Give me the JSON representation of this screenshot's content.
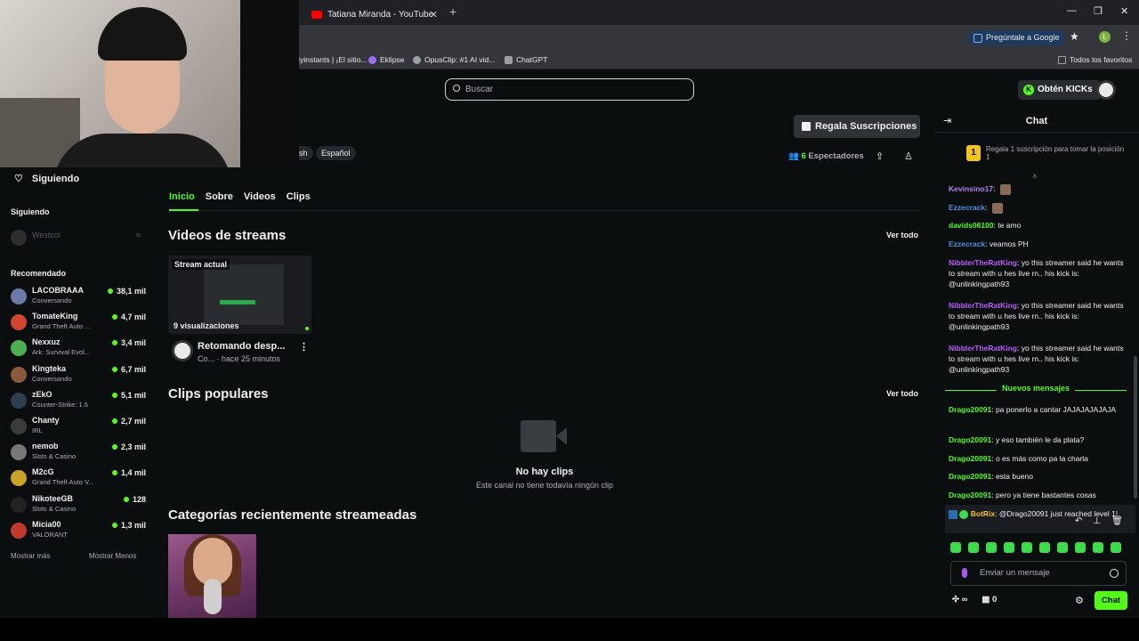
{
  "browser": {
    "tab_title": "Tatiana Miranda - YouTube",
    "ask_google": "Pregúntale a Google",
    "profile_letter": "L",
    "bookmarks": [
      "Myinstants | ¡El sitio...",
      "Eklipse",
      "OpusClip: #1 AI vid...",
      "ChatGPT"
    ],
    "all_bookmarks": "Todos los favoritos"
  },
  "topbar": {
    "search_placeholder": "Buscar",
    "kicks_button": "Obtén KICKs"
  },
  "sidebar": {
    "following_header": "Siguiendo",
    "following_section": "Siguiendo",
    "followed": [
      {
        "name": "Westcol"
      }
    ],
    "recommended_section": "Recomendado",
    "recommended": [
      {
        "name": "LACOBRAAA",
        "category": "Conversando",
        "viewers": "38,1 mil",
        "color": "#6b7aa6"
      },
      {
        "name": "TomateKing",
        "category": "Grand Theft Auto ...",
        "viewers": "4,7 mil",
        "color": "#d2452f"
      },
      {
        "name": "Nexxuz",
        "category": "Ark: Survival Evol...",
        "viewers": "3,4 mil",
        "color": "#4caf50"
      },
      {
        "name": "Kingteka",
        "category": "Conversando",
        "viewers": "6,7 mil",
        "color": "#8b5a3c"
      },
      {
        "name": "zEkO",
        "category": "Counter-Strike: 1.6",
        "viewers": "5,1 mil",
        "color": "#2c3e50"
      },
      {
        "name": "Chanty",
        "category": "IRL",
        "viewers": "2,7 mil",
        "color": "#3b3b3b"
      },
      {
        "name": "nemob",
        "category": "Slots & Casino",
        "viewers": "2,3 mil",
        "color": "#777777"
      },
      {
        "name": "M2cG",
        "category": "Grand Theft Auto V...",
        "viewers": "1,4 mil",
        "color": "#c9a227"
      },
      {
        "name": "NikoteeGB",
        "category": "Slots & Casino",
        "viewers": "128",
        "color": "#222222"
      },
      {
        "name": "Micia00",
        "category": "VALORANT",
        "viewers": "1,3 mil",
        "color": "#c0392b"
      }
    ],
    "show_more": "Mostrar más",
    "show_less": "Mostrar Menos"
  },
  "main": {
    "gift_button": "Regala Suscripciones",
    "tags": [
      "sh",
      "Español"
    ],
    "viewers_count": "6",
    "viewers_label": "Espectadores",
    "tabs": [
      "Inicio",
      "Sobre",
      "Videos",
      "Clips"
    ],
    "videos_section": "Videos de streams",
    "see_all": "Ver todo",
    "video": {
      "badge": "Stream actual",
      "views": "9 visualizaciones",
      "title": "Retomando desp...",
      "meta": "Co... · hace 25 minutos"
    },
    "clips_section": "Clips populares",
    "no_clips_title": "No hay clips",
    "no_clips_sub": "Este canal no tiene todavía ningún clip",
    "categories_section": "Categorías recientemente streameadas"
  },
  "chat": {
    "title": "Chat",
    "goal_badge": "1",
    "goal_text": "Regala 1 suscripción para tomar la posición 1",
    "messages": [
      {
        "user": "Kevinsino17",
        "text": "",
        "color": "#b87ff0",
        "emote": true
      },
      {
        "user": "Ezzecrack",
        "text": "",
        "color": "#4a90e2",
        "emote": true
      },
      {
        "user": "davids06100",
        "text": "te amo",
        "color": "#53fc18",
        "emote": false
      },
      {
        "user": "Ezzecrack",
        "text": "veamos PH",
        "color": "#4a90e2",
        "emote": false
      },
      {
        "user": "NibblerTheRatKing",
        "text": "yo this streamer said he wants to stream with u hes live rn.. his kick is: @unlinkingpath93",
        "color": "#b85cf5",
        "emote": false
      },
      {
        "user": "NibblerTheRatKing",
        "text": "yo this streamer said he wants to stream with u hes live rn.. his kick is: @unlinkingpath93",
        "color": "#b85cf5",
        "emote": false
      },
      {
        "user": "NibblerTheRatKing",
        "text": "yo this streamer said he wants to stream with u hes live rn.. his kick is: @unlinkingpath93",
        "color": "#b85cf5",
        "emote": false
      }
    ],
    "new_messages": "Nuevos mensajes",
    "new_list": [
      {
        "user": "Drago20091",
        "text": "pa ponerlo a cantar JAJAJAJAJAJA"
      },
      {
        "user": "Drago20091",
        "text": "y eso también le da plata?"
      },
      {
        "user": "Drago20091",
        "text": "o es más como pa la charla"
      },
      {
        "user": "Drago20091",
        "text": "esta bueno"
      },
      {
        "user": "Drago20091",
        "text": "pero ya tiene bastantes cosas"
      }
    ],
    "bot_user": "BotRix",
    "bot_text": "@Drago20091 just reached level 1!",
    "input_placeholder": "Enviar un mensaje",
    "points": "∞",
    "store_count": "0",
    "send_button": "Chat"
  }
}
